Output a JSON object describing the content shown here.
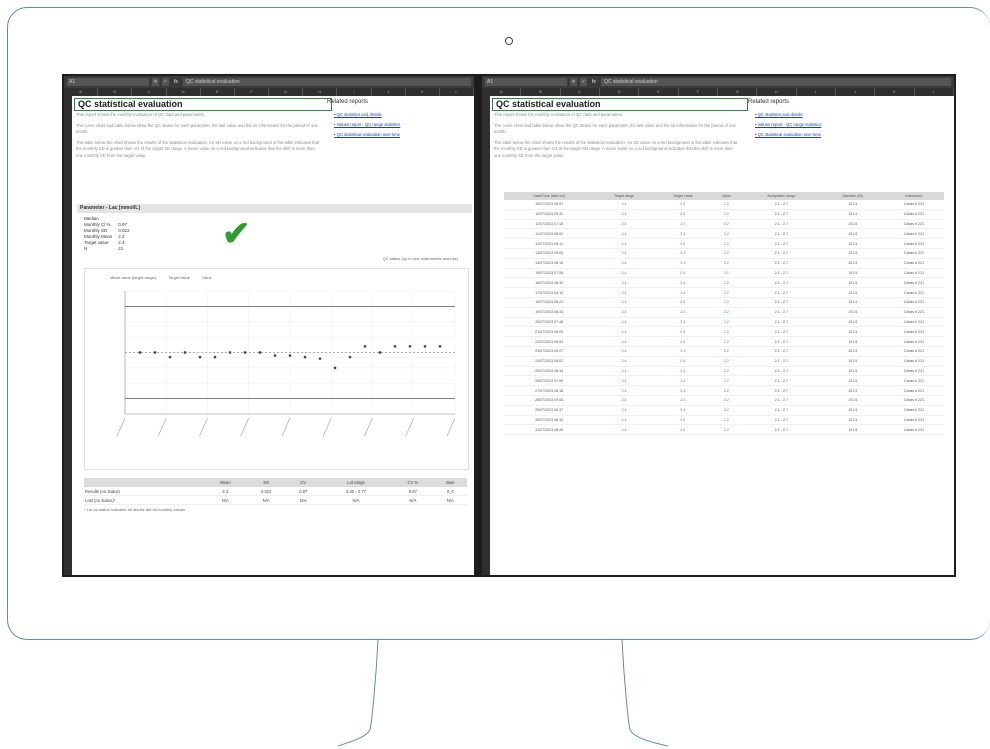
{
  "left": {
    "name_box": "A1",
    "formula": "QC statistical evaluation",
    "title": "QC statistical evaluation",
    "desc": [
      "This report shows the monthly evaluation of QC data and parameters.",
      "The curve chart and table below show the QC status for each parameter, the last value and the lot information for the period of one month.",
      "The table below the chart shows the results of the statistical evaluation. An SD value on a red background in the table indicates that the monthly SD is greater than 1/4 of the target SD range. A mean value on a red background indicates that the shift is more than one monthly SD from the target value."
    ],
    "related_title": "Related reports",
    "related": [
      "QC statistics and details",
      "Values report - QC range statistics",
      "QC statistical evaluation over time"
    ],
    "param_header": "Parameter - Lac [mmol/L]",
    "stats": [
      {
        "label": "Median",
        "value": ""
      },
      {
        "label": "Monthly Cl %",
        "value": "0.97"
      },
      {
        "label": "Monthly SD",
        "value": "0.022"
      },
      {
        "label": "Monthly Mean",
        "value": "2.2"
      },
      {
        "label": "Target value",
        "value": "2.4"
      },
      {
        "label": "N",
        "value": "21"
      }
    ],
    "note": "QC status (up to four instruments and lots)",
    "legend": [
      "Mean value (target range)",
      "Target value",
      "Value"
    ],
    "summary_headers": [
      "",
      "Mean",
      "SD",
      "CV",
      "Lot range",
      "CV %",
      "Bias"
    ],
    "summary_rows": [
      {
        "label": "Results (no status)",
        "values": [
          "2.2",
          "0.022",
          "0.97",
          "2.40 - 2.77",
          "0.97",
          "0_0"
        ]
      },
      {
        "label": "Lost (no status)*",
        "values": [
          "N/A",
          "N/A",
          "N/A",
          "N/A",
          "N/A",
          "N/A"
        ]
      }
    ],
    "summary_note": "* Lot no status indicates all results are for monthly values"
  },
  "right": {
    "name_box": "A1",
    "formula": "QC statistical evaluation",
    "title": "QC statistical evaluation",
    "desc": [
      "This report shows the monthly evaluation of QC data and parameters.",
      "The curve chart and table below show the QC status for each parameter, the last value and the lot information for the period of one month.",
      "The table below the chart shows the results of the statistical evaluation. An SD value on a red background in the table indicates that the monthly SD is greater than 1/4 of the target SD range. A mean value on a red background indicates that the shift is more than one monthly SD from the target value."
    ],
    "related_title": "Related reports",
    "related": [
      "QC statistics and details",
      "Values report - QC range statistics",
      "QC statistical evaluation over time"
    ],
    "table_headers": [
      "Date/Time (last run)",
      "Target range",
      "Target value",
      "Value",
      "Acceptable range",
      "Operator (ID)",
      "Instrument"
    ],
    "rows": [
      [
        "10/07/2023 08:51",
        "2.4",
        "2.4",
        "2.2",
        "2.1 - 2.7",
        "101.5",
        "Cobas b 221"
      ],
      [
        "10/07/2023 09:42",
        "2.4",
        "2.4",
        "2.2",
        "2.1 - 2.7",
        "101.5",
        "Cobas b 221"
      ],
      [
        "11/07/2023 07:18",
        "2.4",
        "2.4",
        "2.2",
        "2.1 - 2.7",
        "101.5",
        "Cobas b 221"
      ],
      [
        "11/07/2023 08:02",
        "2.4",
        "2.4",
        "2.2",
        "2.1 - 2.7",
        "101.5",
        "Cobas b 221"
      ],
      [
        "12/07/2023 08:11",
        "2.4",
        "2.4",
        "2.2",
        "2.1 - 2.7",
        "101.5",
        "Cobas b 221"
      ],
      [
        "13/07/2023 09:03",
        "2.4",
        "2.4",
        "2.2",
        "2.1 - 2.7",
        "101.5",
        "Cobas b 221"
      ],
      [
        "14/07/2023 08:15",
        "2.4",
        "2.4",
        "2.2",
        "2.1 - 2.7",
        "101.5",
        "Cobas b 221"
      ],
      [
        "15/07/2023 07:55",
        "2.4",
        "2.4",
        "2.1",
        "2.1 - 2.7",
        "101.5",
        "Cobas b 221"
      ],
      [
        "16/07/2023 08:40",
        "2.4",
        "2.4",
        "2.2",
        "2.1 - 2.7",
        "101.5",
        "Cobas b 221"
      ],
      [
        "17/07/2023 09:10",
        "2.4",
        "2.4",
        "2.2",
        "2.1 - 2.7",
        "101.5",
        "Cobas b 221"
      ],
      [
        "18/07/2023 08:21",
        "2.4",
        "2.4",
        "2.2",
        "2.1 - 2.7",
        "101.5",
        "Cobas b 221"
      ],
      [
        "19/07/2023 08:33",
        "2.4",
        "2.4",
        "2.2",
        "2.1 - 2.7",
        "101.5",
        "Cobas b 221"
      ],
      [
        "20/07/2023 07:48",
        "2.4",
        "2.4",
        "2.2",
        "2.1 - 2.7",
        "101.5",
        "Cobas b 221"
      ],
      [
        "21/07/2023 08:09",
        "2.4",
        "2.4",
        "2.2",
        "2.1 - 2.7",
        "101.5",
        "Cobas b 221"
      ],
      [
        "22/07/2023 08:54",
        "2.4",
        "2.4",
        "2.2",
        "2.1 - 2.7",
        "101.5",
        "Cobas b 221"
      ],
      [
        "23/07/2023 09:27",
        "2.4",
        "2.4",
        "2.2",
        "2.1 - 2.7",
        "101.5",
        "Cobas b 221"
      ],
      [
        "24/07/2023 08:02",
        "2.4",
        "2.4",
        "2.2",
        "2.1 - 2.7",
        "101.5",
        "Cobas b 221"
      ],
      [
        "25/07/2023 08:44",
        "2.4",
        "2.4",
        "2.2",
        "2.1 - 2.7",
        "101.5",
        "Cobas b 221"
      ],
      [
        "26/07/2023 07:59",
        "2.4",
        "2.4",
        "2.2",
        "2.1 - 2.7",
        "101.5",
        "Cobas b 221"
      ],
      [
        "27/07/2023 08:18",
        "2.4",
        "2.4",
        "2.2",
        "2.1 - 2.7",
        "101.5",
        "Cobas b 221"
      ],
      [
        "28/07/2023 09:05",
        "2.4",
        "2.4",
        "2.2",
        "2.1 - 2.7",
        "101.5",
        "Cobas b 221"
      ],
      [
        "29/07/2023 08:37",
        "2.4",
        "2.4",
        "2.2",
        "2.1 - 2.7",
        "101.5",
        "Cobas b 221"
      ],
      [
        "30/07/2023 08:12",
        "2.4",
        "2.4",
        "2.2",
        "2.1 - 2.7",
        "101.5",
        "Cobas b 221"
      ],
      [
        "31/07/2023 08:49",
        "2.4",
        "2.4",
        "2.2",
        "2.1 - 2.7",
        "101.5",
        "Cobas b 221"
      ]
    ]
  },
  "chart_data": {
    "type": "scatter",
    "title": "",
    "ylim": [
      2.0,
      2.8
    ],
    "grid": true,
    "target_value": 2.4,
    "range_upper": 2.7,
    "range_lower": 2.1,
    "series": [
      {
        "name": "Value",
        "values": [
          2.4,
          2.4,
          2.37,
          2.4,
          2.37,
          2.37,
          2.4,
          2.4,
          2.4,
          2.38,
          2.38,
          2.37,
          2.36,
          2.3,
          2.37,
          2.44,
          2.4,
          2.44,
          2.44,
          2.44,
          2.44
        ]
      }
    ]
  }
}
